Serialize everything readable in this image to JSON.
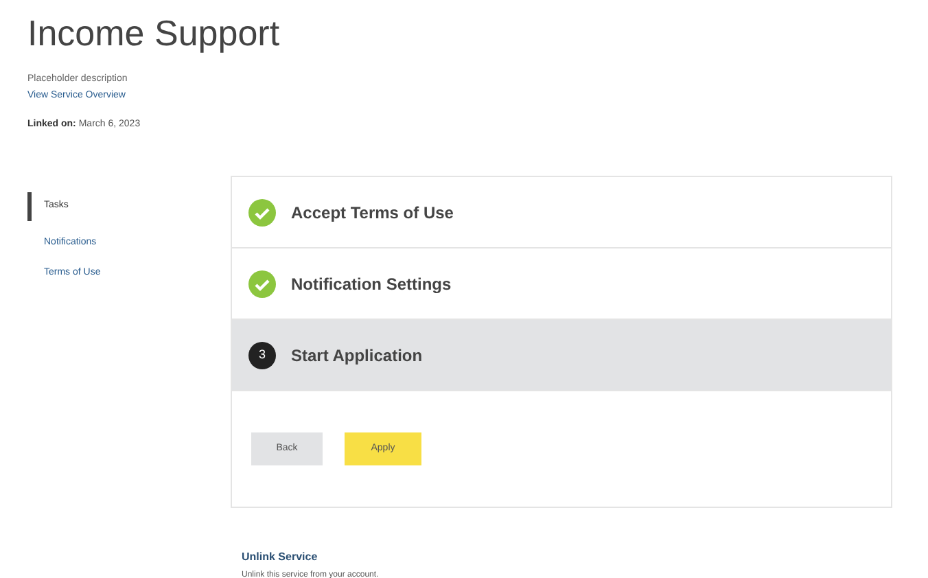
{
  "page": {
    "title": "Income Support",
    "description": "Placeholder description",
    "overview_link": "View Service Overview",
    "linked_label": "Linked on:",
    "linked_date": "March 6, 2023"
  },
  "sidebar": {
    "items": [
      {
        "label": "Tasks",
        "selected": true
      },
      {
        "label": "Notifications",
        "selected": false
      },
      {
        "label": "Terms of Use",
        "selected": false
      }
    ]
  },
  "steps": [
    {
      "kind": "done",
      "title": "Accept Terms of Use",
      "selected": false
    },
    {
      "kind": "done",
      "title": "Notification Settings",
      "selected": false
    },
    {
      "kind": "current",
      "number": "3",
      "title": "Start Application",
      "selected": true
    }
  ],
  "buttons": {
    "back": "Back",
    "apply": "Apply"
  },
  "unlink": {
    "title": "Unlink Service",
    "description": "Unlink this service from your account."
  }
}
